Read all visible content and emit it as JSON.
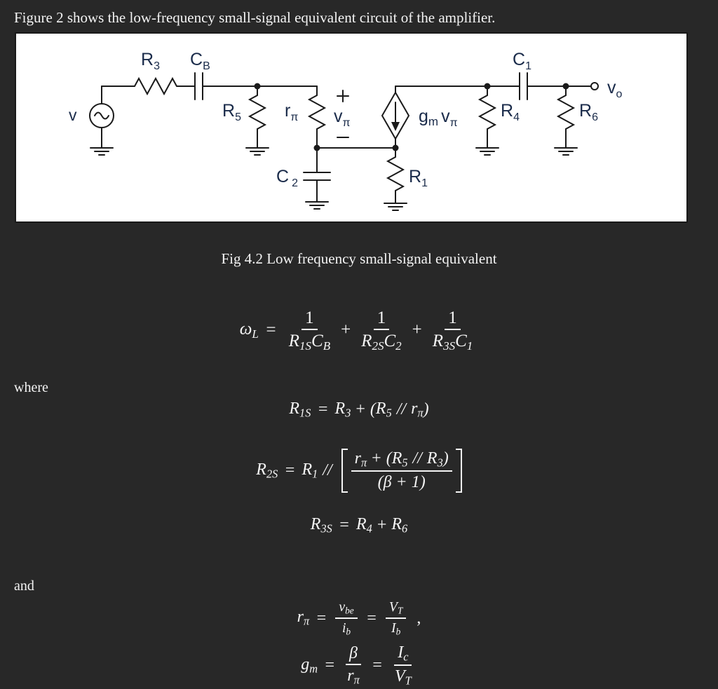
{
  "intro": {
    "text": "Figure 2 shows the low-frequency small-signal equivalent circuit of the amplifier."
  },
  "figure": {
    "caption": "Fig 4.2 Low frequency small-signal equivalent",
    "background_color": "#ffffff",
    "line_color": "#1a1a1a",
    "label_color": "#1a2b4a",
    "components": {
      "source_label": "v",
      "r3_label": "R",
      "r3_sub": "3",
      "cb_label": "C",
      "cb_sub": "B",
      "r5_label": "R",
      "r5_sub": "5",
      "rpi_label": "r",
      "rpi_sub": "π",
      "vpi_label": "v",
      "vpi_sub": "π",
      "plus_sign": "+",
      "minus_sign": "−",
      "c2_label": "C",
      "c2_sub": "2",
      "dep_source_label_g": "g",
      "dep_source_label_m": "m",
      "dep_source_label_v": "v",
      "dep_source_label_pi": "π",
      "r1_label": "R",
      "r1_sub": "1",
      "c1_label": "C",
      "c1_sub": "1",
      "r4_label": "R",
      "r4_sub": "4",
      "r6_label": "R",
      "r6_sub": "6",
      "vo_label": "v",
      "vo_sub": "o"
    }
  },
  "labels": {
    "where": "where",
    "and": "and"
  },
  "equations": {
    "omega_l": {
      "lhs": "ω",
      "lhs_sub": "L",
      "eq": "=",
      "terms": [
        {
          "num": "1",
          "den_r": "R",
          "den_r_sub": "1S",
          "den_c": "C",
          "den_c_sub": "B"
        },
        {
          "num": "1",
          "den_r": "R",
          "den_r_sub": "2S",
          "den_c": "C",
          "den_c_sub": "2"
        },
        {
          "num": "1",
          "den_r": "R",
          "den_r_sub": "3S",
          "den_c": "C",
          "den_c_sub": "1"
        }
      ],
      "plus": "+"
    },
    "r1s": {
      "lhs": "R",
      "lhs_sub": "1S",
      "eq": "=",
      "t1": "R",
      "t1_sub": "3",
      "plus": "+",
      "open": "(",
      "t2": "R",
      "t2_sub": "5",
      "parallel": "//",
      "t3": "r",
      "t3_sub": "π",
      "close": ")"
    },
    "r2s": {
      "lhs": "R",
      "lhs_sub": "2S",
      "eq": "=",
      "t1": "R",
      "t1_sub": "1",
      "parallel": "//",
      "num_r": "r",
      "num_r_sub": "π",
      "num_plus": "+",
      "num_open": "(",
      "num_t1": "R",
      "num_t1_sub": "5",
      "num_parallel": "//",
      "num_t2": "R",
      "num_t2_sub": "3",
      "num_close": ")",
      "den": "(β + 1)"
    },
    "r3s": {
      "lhs": "R",
      "lhs_sub": "3S",
      "eq": "=",
      "t1": "R",
      "t1_sub": "4",
      "plus": "+",
      "t2": "R",
      "t2_sub": "6"
    },
    "r_pi": {
      "lhs": "r",
      "lhs_sub": "π",
      "eq1": "=",
      "f1_num": "v",
      "f1_num_sub": "be",
      "f1_den": "i",
      "f1_den_sub": "b",
      "eq2": "=",
      "f2_num": "V",
      "f2_num_sub": "T",
      "f2_den": "I",
      "f2_den_sub": "b",
      "comma": ","
    },
    "g_m": {
      "lhs": "g",
      "lhs_sub": "m",
      "eq1": "=",
      "f1_num": "β",
      "f1_den": "r",
      "f1_den_sub": "π",
      "eq2": "=",
      "f2_num": "I",
      "f2_num_sub": "c",
      "f2_den": "V",
      "f2_den_sub": "T"
    }
  }
}
